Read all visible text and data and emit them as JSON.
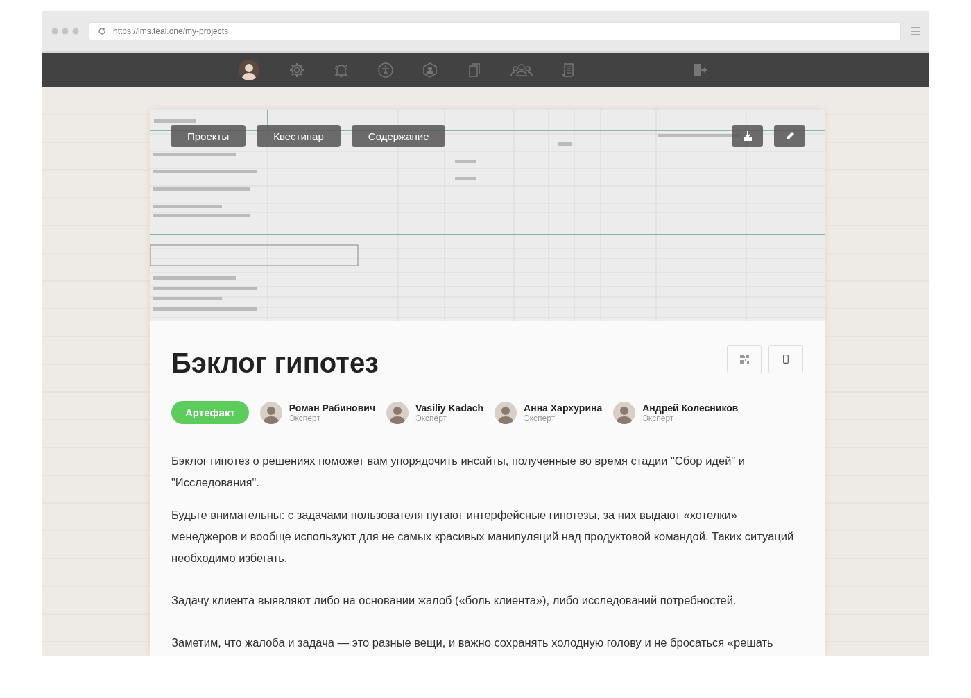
{
  "browser": {
    "url": "https://lms.teal.one/my-projects"
  },
  "nav": {
    "items": [
      {
        "kind": "avatar"
      },
      {
        "kind": "gear"
      },
      {
        "kind": "bell"
      },
      {
        "kind": "accessibility"
      },
      {
        "kind": "user-shield"
      },
      {
        "kind": "copy"
      },
      {
        "kind": "group"
      },
      {
        "kind": "scroll"
      },
      {
        "kind": "exit"
      }
    ]
  },
  "cover": {
    "tabs": [
      "Проекты",
      "Квестинар",
      "Содержание"
    ]
  },
  "article": {
    "title": "Бэклог гипотез",
    "badge": "Артефакт",
    "experts": [
      {
        "name": "Роман Рабинович",
        "role": "Эксперт"
      },
      {
        "name": "Vasiliy Kadach",
        "role": "Эксперт"
      },
      {
        "name": "Анна Хархурина",
        "role": "Эксперт"
      },
      {
        "name": "Андрей Колесников",
        "role": "Эксперт"
      }
    ],
    "paragraphs": [
      "Бэклог гипотез о решениях поможет вам упорядочить инсайты, полученные во время стадии \"Сбор идей\" и \"Исследования\".",
      "Будьте внимательны: с задачами пользователя путают интерфейсные гипотезы, за них выдают «хотелки» менеджеров и вообще используют для не самых красивых манипуляций над продуктовой командой. Таких ситуаций необходимо избегать.",
      "Задачу клиента выявляют либо на основании жалоб («боль клиента»), либо исследований потребностей.",
      "Заметим, что жалоба и задача — это разные вещи, и важно сохранять холодную голову и не бросаться «решать"
    ]
  }
}
